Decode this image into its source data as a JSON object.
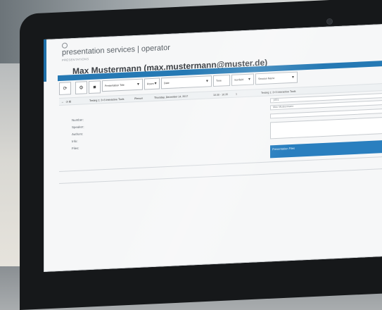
{
  "app": {
    "title": "presentation services | operator",
    "subtitle": "PRESENTATIONS",
    "user_title": "Max Mustermann (max.mustermann@muster.de)"
  },
  "toolbar": {
    "icons": [
      "refresh-icon",
      "settings-icon",
      "save-icon"
    ],
    "columns": [
      {
        "label": "Presentation Title"
      },
      {
        "label": "Room"
      },
      {
        "label": "Date"
      },
      {
        "label": "Time"
      },
      {
        "label": "Sortfield"
      },
      {
        "label": "Session Name"
      }
    ]
  },
  "row": {
    "title": "Testing 1: 3+3 Interactive Tools",
    "room": "Plenum",
    "date": "Thursday, December 14, 2017",
    "time": "10:30 - 10:35",
    "sort": "1",
    "session": "Testing 1: 3+3 Interactive Tools"
  },
  "details": {
    "labels": [
      "Number:",
      "Speaker:",
      "Authors:",
      "Info:",
      "Files:"
    ],
    "number_value": "1001",
    "speaker_value": "Max Mustermann",
    "files_panel": "Presentation Files"
  },
  "colors": {
    "accent": "#2579b4"
  }
}
